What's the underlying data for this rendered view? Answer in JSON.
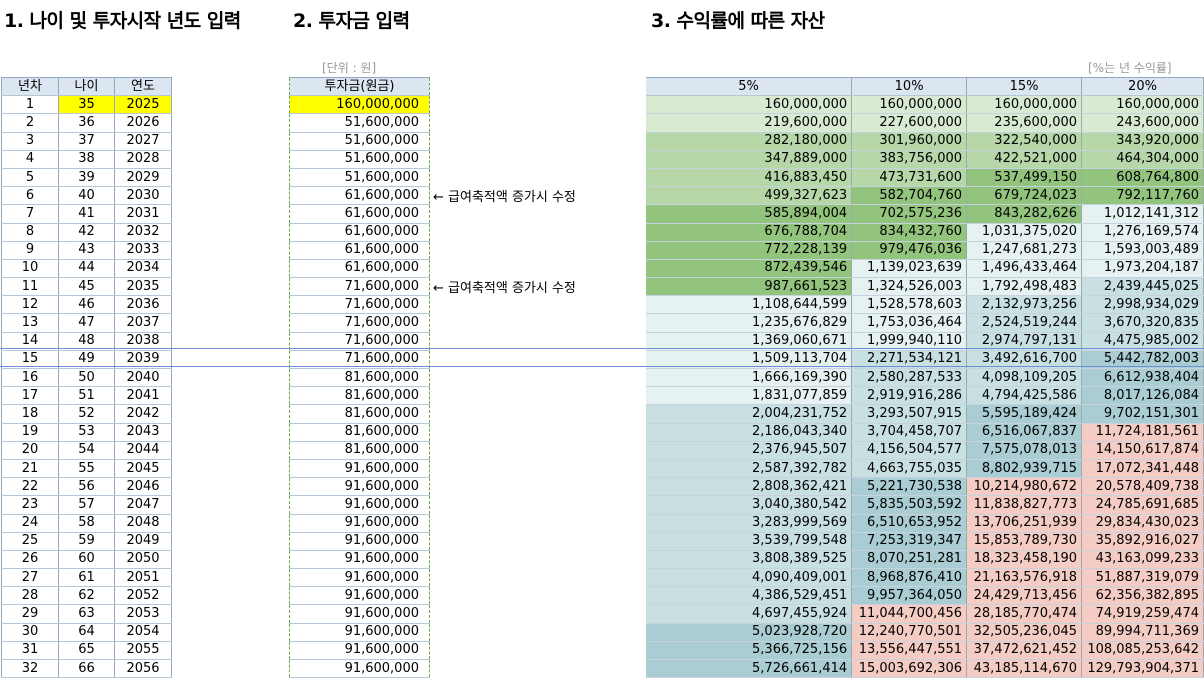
{
  "titles": {
    "section1": "1. 나이 및 투자시작 년도 입력",
    "section2": "2. 투자금 입력",
    "section3": "3. 수익률에 따른 자산"
  },
  "notes": {
    "unit": "[단위 : 원]",
    "rate": "[%는 년 수익률]",
    "salary_note": "← 급여축적액 증가시 수정"
  },
  "headers": {
    "year_no": "년차",
    "age": "나이",
    "year": "연도",
    "investment": "투자금(원금)",
    "rates": [
      "5%",
      "10%",
      "15%",
      "20%"
    ]
  },
  "colors": {
    "green_dark": "#93c47d",
    "green_mid": "#b6d7a8",
    "green_light": "#d9ead3",
    "blue_light": "#e6f1f2",
    "blue_mid": "#c9e0e3",
    "blue_dark": "#a9cdd3",
    "salmon": "#f4ccc4"
  },
  "rows": [
    {
      "n": "1",
      "age": "35",
      "year": "2025",
      "inv": "160,000,000",
      "r5": "160,000,000",
      "r10": "160,000,000",
      "r15": "160,000,000",
      "r20": "160,000,000"
    },
    {
      "n": "2",
      "age": "36",
      "year": "2026",
      "inv": "51,600,000",
      "r5": "219,600,000",
      "r10": "227,600,000",
      "r15": "235,600,000",
      "r20": "243,600,000"
    },
    {
      "n": "3",
      "age": "37",
      "year": "2027",
      "inv": "51,600,000",
      "r5": "282,180,000",
      "r10": "301,960,000",
      "r15": "322,540,000",
      "r20": "343,920,000"
    },
    {
      "n": "4",
      "age": "38",
      "year": "2028",
      "inv": "51,600,000",
      "r5": "347,889,000",
      "r10": "383,756,000",
      "r15": "422,521,000",
      "r20": "464,304,000"
    },
    {
      "n": "5",
      "age": "39",
      "year": "2029",
      "inv": "51,600,000",
      "r5": "416,883,450",
      "r10": "473,731,600",
      "r15": "537,499,150",
      "r20": "608,764,800"
    },
    {
      "n": "6",
      "age": "40",
      "year": "2030",
      "inv": "61,600,000",
      "r5": "499,327,623",
      "r10": "582,704,760",
      "r15": "679,724,023",
      "r20": "792,117,760"
    },
    {
      "n": "7",
      "age": "41",
      "year": "2031",
      "inv": "61,600,000",
      "r5": "585,894,004",
      "r10": "702,575,236",
      "r15": "843,282,626",
      "r20": "1,012,141,312"
    },
    {
      "n": "8",
      "age": "42",
      "year": "2032",
      "inv": "61,600,000",
      "r5": "676,788,704",
      "r10": "834,432,760",
      "r15": "1,031,375,020",
      "r20": "1,276,169,574"
    },
    {
      "n": "9",
      "age": "43",
      "year": "2033",
      "inv": "61,600,000",
      "r5": "772,228,139",
      "r10": "979,476,036",
      "r15": "1,247,681,273",
      "r20": "1,593,003,489"
    },
    {
      "n": "10",
      "age": "44",
      "year": "2034",
      "inv": "61,600,000",
      "r5": "872,439,546",
      "r10": "1,139,023,639",
      "r15": "1,496,433,464",
      "r20": "1,973,204,187"
    },
    {
      "n": "11",
      "age": "45",
      "year": "2035",
      "inv": "71,600,000",
      "r5": "987,661,523",
      "r10": "1,324,526,003",
      "r15": "1,792,498,483",
      "r20": "2,439,445,025"
    },
    {
      "n": "12",
      "age": "46",
      "year": "2036",
      "inv": "71,600,000",
      "r5": "1,108,644,599",
      "r10": "1,528,578,603",
      "r15": "2,132,973,256",
      "r20": "2,998,934,029"
    },
    {
      "n": "13",
      "age": "47",
      "year": "2037",
      "inv": "71,600,000",
      "r5": "1,235,676,829",
      "r10": "1,753,036,464",
      "r15": "2,524,519,244",
      "r20": "3,670,320,835"
    },
    {
      "n": "14",
      "age": "48",
      "year": "2038",
      "inv": "71,600,000",
      "r5": "1,369,060,671",
      "r10": "1,999,940,110",
      "r15": "2,974,797,131",
      "r20": "4,475,985,002"
    },
    {
      "n": "15",
      "age": "49",
      "year": "2039",
      "inv": "71,600,000",
      "r5": "1,509,113,704",
      "r10": "2,271,534,121",
      "r15": "3,492,616,700",
      "r20": "5,442,782,003"
    },
    {
      "n": "16",
      "age": "50",
      "year": "2040",
      "inv": "81,600,000",
      "r5": "1,666,169,390",
      "r10": "2,580,287,533",
      "r15": "4,098,109,205",
      "r20": "6,612,938,404"
    },
    {
      "n": "17",
      "age": "51",
      "year": "2041",
      "inv": "81,600,000",
      "r5": "1,831,077,859",
      "r10": "2,919,916,286",
      "r15": "4,794,425,586",
      "r20": "8,017,126,084"
    },
    {
      "n": "18",
      "age": "52",
      "year": "2042",
      "inv": "81,600,000",
      "r5": "2,004,231,752",
      "r10": "3,293,507,915",
      "r15": "5,595,189,424",
      "r20": "9,702,151,301"
    },
    {
      "n": "19",
      "age": "53",
      "year": "2043",
      "inv": "81,600,000",
      "r5": "2,186,043,340",
      "r10": "3,704,458,707",
      "r15": "6,516,067,837",
      "r20": "11,724,181,561"
    },
    {
      "n": "20",
      "age": "54",
      "year": "2044",
      "inv": "81,600,000",
      "r5": "2,376,945,507",
      "r10": "4,156,504,577",
      "r15": "7,575,078,013",
      "r20": "14,150,617,874"
    },
    {
      "n": "21",
      "age": "55",
      "year": "2045",
      "inv": "91,600,000",
      "r5": "2,587,392,782",
      "r10": "4,663,755,035",
      "r15": "8,802,939,715",
      "r20": "17,072,341,448"
    },
    {
      "n": "22",
      "age": "56",
      "year": "2046",
      "inv": "91,600,000",
      "r5": "2,808,362,421",
      "r10": "5,221,730,538",
      "r15": "10,214,980,672",
      "r20": "20,578,409,738"
    },
    {
      "n": "23",
      "age": "57",
      "year": "2047",
      "inv": "91,600,000",
      "r5": "3,040,380,542",
      "r10": "5,835,503,592",
      "r15": "11,838,827,773",
      "r20": "24,785,691,685"
    },
    {
      "n": "24",
      "age": "58",
      "year": "2048",
      "inv": "91,600,000",
      "r5": "3,283,999,569",
      "r10": "6,510,653,952",
      "r15": "13,706,251,939",
      "r20": "29,834,430,023"
    },
    {
      "n": "25",
      "age": "59",
      "year": "2049",
      "inv": "91,600,000",
      "r5": "3,539,799,548",
      "r10": "7,253,319,347",
      "r15": "15,853,789,730",
      "r20": "35,892,916,027"
    },
    {
      "n": "26",
      "age": "60",
      "year": "2050",
      "inv": "91,600,000",
      "r5": "3,808,389,525",
      "r10": "8,070,251,281",
      "r15": "18,323,458,190",
      "r20": "43,163,099,233"
    },
    {
      "n": "27",
      "age": "61",
      "year": "2051",
      "inv": "91,600,000",
      "r5": "4,090,409,001",
      "r10": "8,968,876,410",
      "r15": "21,163,576,918",
      "r20": "51,887,319,079"
    },
    {
      "n": "28",
      "age": "62",
      "year": "2052",
      "inv": "91,600,000",
      "r5": "4,386,529,451",
      "r10": "9,957,364,050",
      "r15": "24,429,713,456",
      "r20": "62,356,382,895"
    },
    {
      "n": "29",
      "age": "63",
      "year": "2053",
      "inv": "91,600,000",
      "r5": "4,697,455,924",
      "r10": "11,044,700,456",
      "r15": "28,185,770,474",
      "r20": "74,919,259,474"
    },
    {
      "n": "30",
      "age": "64",
      "year": "2054",
      "inv": "91,600,000",
      "r5": "5,023,928,720",
      "r10": "12,240,770,501",
      "r15": "32,505,236,045",
      "r20": "89,994,711,369"
    },
    {
      "n": "31",
      "age": "65",
      "year": "2055",
      "inv": "91,600,000",
      "r5": "5,366,725,156",
      "r10": "13,556,447,551",
      "r15": "37,472,621,452",
      "r20": "108,085,253,642"
    },
    {
      "n": "32",
      "age": "66",
      "year": "2056",
      "inv": "91,600,000",
      "r5": "5,726,661,414",
      "r10": "15,003,692,306",
      "r15": "43,185,114,670",
      "r20": "129,793,904,371"
    }
  ]
}
